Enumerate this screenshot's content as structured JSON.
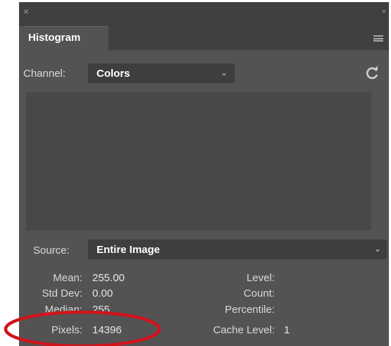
{
  "window": {
    "close_icon": "close-icon",
    "collapse_icon": "collapse-panel-icon",
    "close_glyph": "×",
    "collapse_glyph": "‹‹"
  },
  "tab": {
    "label": "Histogram",
    "menu_icon": "panel-menu-icon"
  },
  "channel": {
    "label": "Channel:",
    "value": "Colors",
    "refresh_icon": "refresh-icon"
  },
  "source": {
    "label": "Source:",
    "value": "Entire Image"
  },
  "stats_left": {
    "mean_label": "Mean:",
    "mean_value": "255.00",
    "std_label": "Std Dev:",
    "std_value": "0.00",
    "median_label": "Median:",
    "median_value": "255",
    "pixels_label": "Pixels:",
    "pixels_value": "14396"
  },
  "stats_right": {
    "level_label": "Level:",
    "count_label": "Count:",
    "percentile_label": "Percentile:",
    "cache_label": "Cache Level:",
    "cache_value": "1"
  },
  "colors": {
    "panel_bg": "#535353",
    "field_bg": "#3e3e3e",
    "annotation": "#d0141c"
  }
}
